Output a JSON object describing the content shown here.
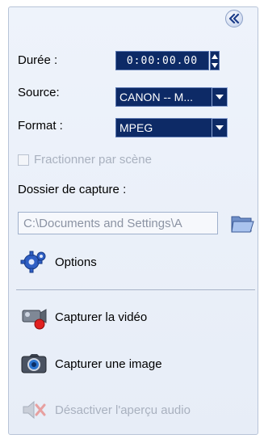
{
  "collapse": {
    "glyph": "«"
  },
  "duration": {
    "label": "Durée :",
    "value": "0:00:00.00"
  },
  "source": {
    "label": "Source:",
    "value": "CANON -- M..."
  },
  "format": {
    "label": "Format :",
    "value": "MPEG"
  },
  "split_by_scene": {
    "label": "Fractionner par scène",
    "checked": false,
    "enabled": false
  },
  "capture_folder": {
    "label": "Dossier de capture :",
    "path": "C:\\Documents and Settings\\A"
  },
  "options": {
    "label": "Options"
  },
  "actions": {
    "capture_video": "Capturer la vidéo",
    "capture_image": "Capturer une image",
    "disable_audio_preview": "Désactiver l'aperçu audio"
  },
  "colors": {
    "control_bg": "#0d2a66",
    "panel_bg": "#eef3fb",
    "disabled_text": "#a9b1bf",
    "record_red": "#e02020"
  }
}
